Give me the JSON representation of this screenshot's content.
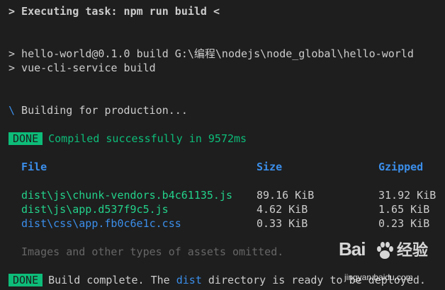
{
  "terminal": {
    "task_line": "> Executing task: npm run build <",
    "cmd_line_1": "> hello-world@0.1.0 build G:\\编程\\nodejs\\node_global\\hello-world",
    "cmd_line_2": "> vue-cli-service build",
    "spinner_char": "\\",
    "building_text": " Building for production...",
    "done_badge_1": "DONE",
    "compiled_text": "Compiled successfully in 9572ms",
    "table": {
      "headers": [
        "File",
        "Size",
        "Gzipped"
      ],
      "rows": [
        {
          "file": "dist\\js\\chunk-vendors.b4c61135.js",
          "size": "89.16 KiB",
          "gzipped": "31.92 KiB",
          "type": "js"
        },
        {
          "file": "dist\\js\\app.d537f9c5.js",
          "size": "4.62 KiB",
          "gzipped": "1.65 KiB",
          "type": "js"
        },
        {
          "file": "dist\\css\\app.fb0c6e1c.css",
          "size": "0.33 KiB",
          "gzipped": "0.23 KiB",
          "type": "css"
        }
      ]
    },
    "omitted_text": "Images and other types of assets omitted.",
    "done_badge_2": "DONE",
    "complete_prefix": "Build complete. The ",
    "complete_dist": "dist",
    "complete_suffix": " directory is ready to be deployed."
  },
  "watermark": {
    "logo": "Bai",
    "logo_suffix": "经验",
    "url": "jingyan.baidu.com"
  },
  "colors": {
    "background": "#1e1e1e",
    "text": "#cccccc",
    "green": "#23d18b",
    "badge": "#0dbc79",
    "blue": "#3b8eea",
    "gray": "#666666"
  }
}
